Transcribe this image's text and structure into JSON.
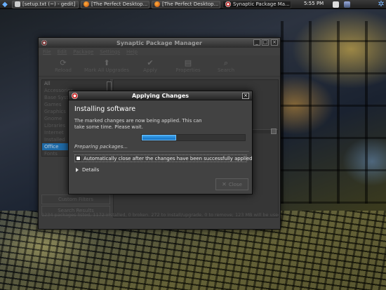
{
  "panel": {
    "taskbar": [
      {
        "label": "[setup.txt (~) - gedit]",
        "icon": "text-document-icon"
      },
      {
        "label": "[The Perfect Desktop...",
        "icon": "firefox-icon"
      },
      {
        "label": "[The Perfect Desktop...",
        "icon": "firefox-icon"
      },
      {
        "label": "Synaptic Package Ma...",
        "icon": "synaptic-icon"
      }
    ],
    "clock": "5:55 PM"
  },
  "synaptic": {
    "title": "Synaptic Package Manager",
    "menu": [
      "File",
      "Edit",
      "Package",
      "Settings",
      "Help"
    ],
    "toolbar": [
      {
        "label": "Reload",
        "icon": "reload-icon"
      },
      {
        "label": "Mark All Upgrades",
        "icon": "upgrade-icon"
      },
      {
        "label": "Apply",
        "icon": "apply-icon"
      },
      {
        "label": "Properties",
        "icon": "properties-icon"
      },
      {
        "label": "Search",
        "icon": "search-icon"
      }
    ],
    "filters": [
      "All",
      "Accessories",
      "Base System",
      "Games",
      "Graphics",
      "Gnome",
      "Libraries",
      "Internet",
      "Installed",
      "Office",
      "Fonts"
    ],
    "side_buttons": [
      "Custom Filters",
      "Search Results"
    ],
    "status": "1234 packages listed, 1172 installed, 0 broken. 272 to install/upgrade, 0 to remove; 123 MB will be used"
  },
  "dialog": {
    "title": "Applying Changes",
    "heading": "Installing software",
    "description": "The marked changes are now being applied. This can take some time. Please wait.",
    "progress": 0.33,
    "status": "Preparing packages...",
    "auto_close_label": "Automatically close after the changes have been successfully applied",
    "auto_close_checked": false,
    "details_label": "Details",
    "close_label": "Close"
  },
  "colors": {
    "progress_fill": "#1f7fd0",
    "selection": "#1f6aa6"
  }
}
